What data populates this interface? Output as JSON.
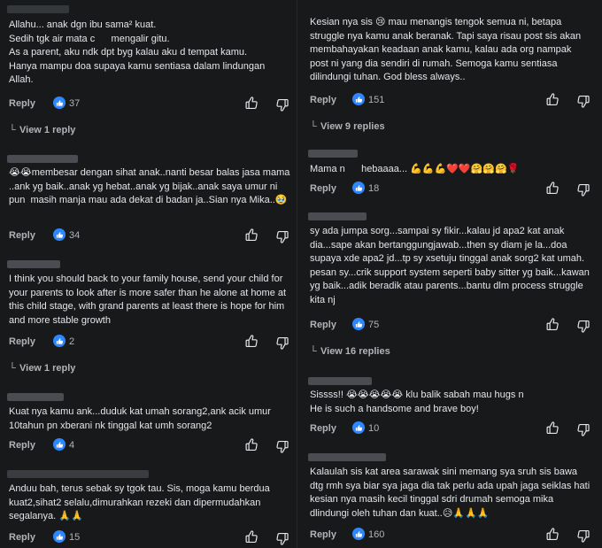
{
  "left_comments": [
    {
      "text": "Allahu... anak dgn ibu sama² kuat.\nSedih tgk air mata c      mengalir gitu.\nAs a parent, aku ndk dpt byg kalau aku d tempat kamu.\nHanya mampu doa supaya kamu sentiasa dalam lindungan Allah.",
      "reply_label": "Reply",
      "likes": "37"
    },
    {
      "text": "😭😭membesar dengan sihat anak..nanti besar balas jasa mama ..ank yg baik..anak yg hebat..anak yg bijak..anak saya umur ni pun  masih manja mau ada dekat di badan ja..Sian nya Mika..🥹",
      "reply_label": "Reply",
      "likes": "34"
    },
    {
      "text": "I think you should back to your family house, send your child for your parents to look after is more safer than he alone at home at this child stage, with grand parents at least there is hope for him and more stable growth",
      "reply_label": "Reply",
      "likes": "2"
    },
    {
      "text": "Kuat nya kamu ank...duduk kat umah sorang2,ank acik umur 10tahun pn xberani nk tinggal kat umh sorang2",
      "reply_label": "Reply",
      "likes": "4"
    },
    {
      "text": "Anduu bah, terus sebak sy tgok tau. Sis, moga kamu berdua kuat2,sihat2 selalu,dimurahkan rezeki dan dipermudahkan segalanya. 🙏🙏",
      "reply_label": "Reply",
      "likes": "15"
    }
  ],
  "left_view_replies": [
    "View 1 reply",
    "View 1 reply"
  ],
  "right_comments": [
    {
      "text": "Kesian nya sis 😢 mau menangis tengok semua ni, betapa struggle nya kamu anak beranak. Tapi saya risau post sis akan membahayakan keadaan anak kamu, kalau ada org nampak post ni yang dia sendiri di rumah. Semoga kamu sentiasa dilindungi tuhan. God bless always..",
      "reply_label": "Reply",
      "likes": "151"
    },
    {
      "text": "Mama n      hebaaaa... 💪💪💪❤️❤️🤗🤗🤗🌹",
      "reply_label": "Reply",
      "likes": "18"
    },
    {
      "text": "sy ada jumpa sorg...sampai sy fikir...kalau jd apa2 kat anak dia...sape akan bertanggungjawab...then sy diam je la...doa supaya xde apa2 jd...tp sy xsetuju tinggal anak sorg2 kat umah. pesan sy...crik support system seperti baby sitter yg baik...kawan yg baik...adik beradik atau parents...bantu dlm process struggle kita nj",
      "reply_label": "Reply",
      "likes": "75"
    },
    {
      "text": "Sissss!! 😭😭😭😭😭 klu balik sabah mau hugs n\nHe is such a handsome and brave boy!",
      "reply_label": "Reply",
      "likes": "10"
    },
    {
      "text": "Kalaulah sis kat area sarawak sini memang sya sruh sis bawa dtg rmh sya biar sya jaga dia tak perlu ada upah jaga seiklas hati kesian nya masih kecil tinggal sdri drumah semoga mika dlindungi oleh tuhan dan kuat..😥🙏🙏🙏",
      "reply_label": "Reply",
      "likes": "160"
    }
  ],
  "right_view_replies": [
    "View 9 replies",
    "View 16 replies"
  ],
  "icons": {
    "like_badge": "like-badge-icon",
    "thumbs_up": "thumbs-up-outline-icon",
    "thumbs_down": "thumbs-down-outline-icon",
    "chevron": "reply-arrow-icon"
  },
  "colors": {
    "background": "#18191b",
    "text": "#e4e6eb",
    "muted": "#b0b3b8",
    "like_blue": "#2d88ff"
  }
}
